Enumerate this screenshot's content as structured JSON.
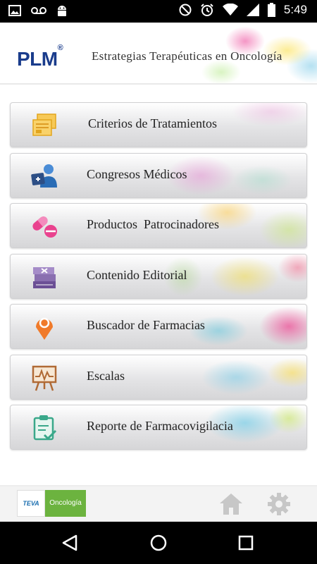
{
  "status_bar": {
    "time": "5:49",
    "icons_left": [
      "image-icon",
      "voicemail-icon",
      "android-icon"
    ],
    "icons_right": [
      "do-not-disturb-icon",
      "alarm-icon",
      "wifi-icon",
      "signal-icon",
      "battery-icon"
    ]
  },
  "header": {
    "logo": "PLM",
    "logo_mark": "®",
    "title": "Estrategias Terapéuticas en Oncología"
  },
  "menu": {
    "items": [
      {
        "label": "Criterios de Tratamientos",
        "icon": "documents-icon",
        "icon_color": "#f0b429"
      },
      {
        "label": "Congresos Médicos",
        "icon": "doctor-icon",
        "icon_color": "#2a6cb5"
      },
      {
        "label": "Productos  Patrocinadores",
        "icon": "pills-icon",
        "icon_color": "#e9428e"
      },
      {
        "label": "Contenido Editorial",
        "icon": "books-icon",
        "icon_color": "#8a6fb0"
      },
      {
        "label": "Buscador de Farmacias",
        "icon": "location-pin-icon",
        "icon_color": "#f07a2a"
      },
      {
        "label": "Escalas",
        "icon": "chart-easel-icon",
        "icon_color": "#b06a35"
      },
      {
        "label": "Reporte de Farmacovigilacia",
        "icon": "clipboard-check-icon",
        "icon_color": "#3aa88a"
      }
    ]
  },
  "footer": {
    "teva_label": "TEVA",
    "oncology_label": "Oncología",
    "oncology_color": "#6cb33f"
  }
}
